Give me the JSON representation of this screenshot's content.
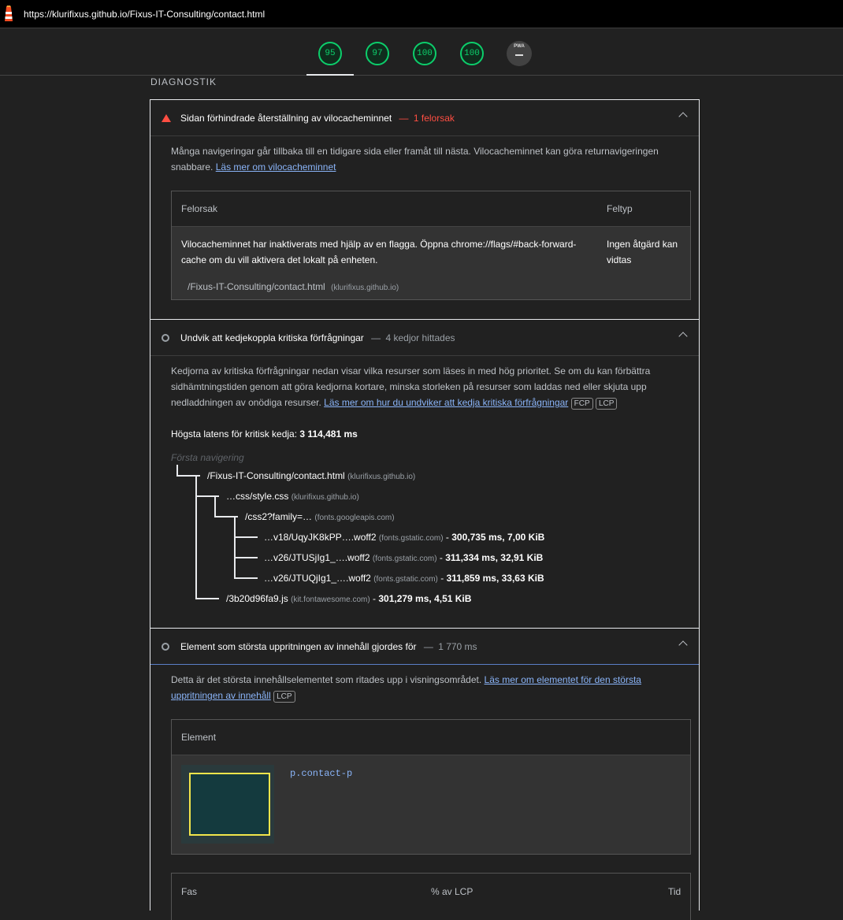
{
  "browser": {
    "url": "https://klurifixus.github.io/Fixus-IT-Consulting/contact.html"
  },
  "scores": [
    {
      "label": "95",
      "value": 95
    },
    {
      "label": "97",
      "value": 97
    },
    {
      "label": "100",
      "value": 100
    },
    {
      "label": "100",
      "value": 100
    }
  ],
  "pwa": {
    "label": "PWA",
    "value": "–"
  },
  "section_title": "DIAGNOSTIK",
  "audit1": {
    "title": "Sidan förhindrade återställning av vilocachen­minnet",
    "title_plain": "Sidan förhindrade återställning av vilocacheminnet",
    "sep": "—",
    "summary": "1 felorsak",
    "desc": "Många navigeringar går tillbaka till en tidigare sida eller framåt till nästa. Vilocacheminnet kan göra returnavigeringen snabbare.",
    "link": "Läs mer om vilocacheminnet",
    "col1": "Felorsak",
    "col2": "Feltyp",
    "row_reason": "Vilocacheminnet har inaktiverats med hjälp av en flagga. Öppna chrome://flags/#back-forward-cache om du vill aktivera det lokalt på enheten.",
    "row_type": "Ingen åtgärd kan vidtas",
    "row_url": "/Fixus-IT-Consulting/contact.html",
    "row_domain": "(klurifixus.github.io)"
  },
  "audit2": {
    "title": "Undvik att kedjekoppla kritiska förfrågningar",
    "sep": "—",
    "summary": "4 kedjor hittades",
    "desc": "Kedjorna av kritiska förfrågningar nedan visar vilka resurser som läses in med hög prioritet. Se om du kan förbättra sidhämtningstiden genom att göra kedjorna kortare, minska storleken på resurser som laddas ned eller skjuta upp nedladdningen av onödiga resurser.",
    "link": "Läs mer om hur du undviker att kedja kritiska förfrågningar",
    "chip1": "FCP",
    "chip2": "LCP",
    "latency_label": "Högsta latens för kritisk kedja:",
    "latency_value": "3 114,481 ms",
    "nav_label": "Första navigering",
    "chain": [
      {
        "path": "/Fixus-IT-Consulting/contact.html",
        "domain": "(klurifixus.github.io)",
        "stats": ""
      },
      {
        "path": "…css/style.css",
        "domain": "(klurifixus.github.io)",
        "stats": ""
      },
      {
        "path": "/css2?family=…",
        "domain": "(fonts.googleapis.com)",
        "stats": ""
      },
      {
        "path": "…v18/UqyJK8kPP….woff2",
        "domain": "(fonts.gstatic.com)",
        "stats": "300,735 ms, 7,00 KiB"
      },
      {
        "path": "…v26/JTUSjIg1_….woff2",
        "domain": "(fonts.gstatic.com)",
        "stats": "311,334 ms, 32,91 KiB"
      },
      {
        "path": "…v26/JTUQjIg1_….woff2",
        "domain": "(fonts.gstatic.com)",
        "stats": "311,859 ms, 33,63 KiB"
      },
      {
        "path": "/3b20d96fa9.js",
        "domain": "(kit.fontawesome.com)",
        "stats": "301,279 ms, 4,51 KiB"
      }
    ],
    "dash": " - "
  },
  "audit3": {
    "title": "Element som största uppritningen av innehåll gjordes för",
    "sep": "—",
    "summary": "1 770 ms",
    "desc": "Detta är det största innehållselementet som ritades upp i visningsområdet.",
    "link": "Läs mer om elementet för den största uppritningen av innehåll",
    "chip": "LCP",
    "col_element": "Element",
    "selector": "p.contact-p",
    "phase_cols": [
      "Fas",
      "% av LCP",
      "Tid"
    ]
  },
  "colors": {
    "pass": "#0cce6b",
    "fail": "#ff4e42",
    "link": "#8ab4f8",
    "background": "#212121"
  }
}
